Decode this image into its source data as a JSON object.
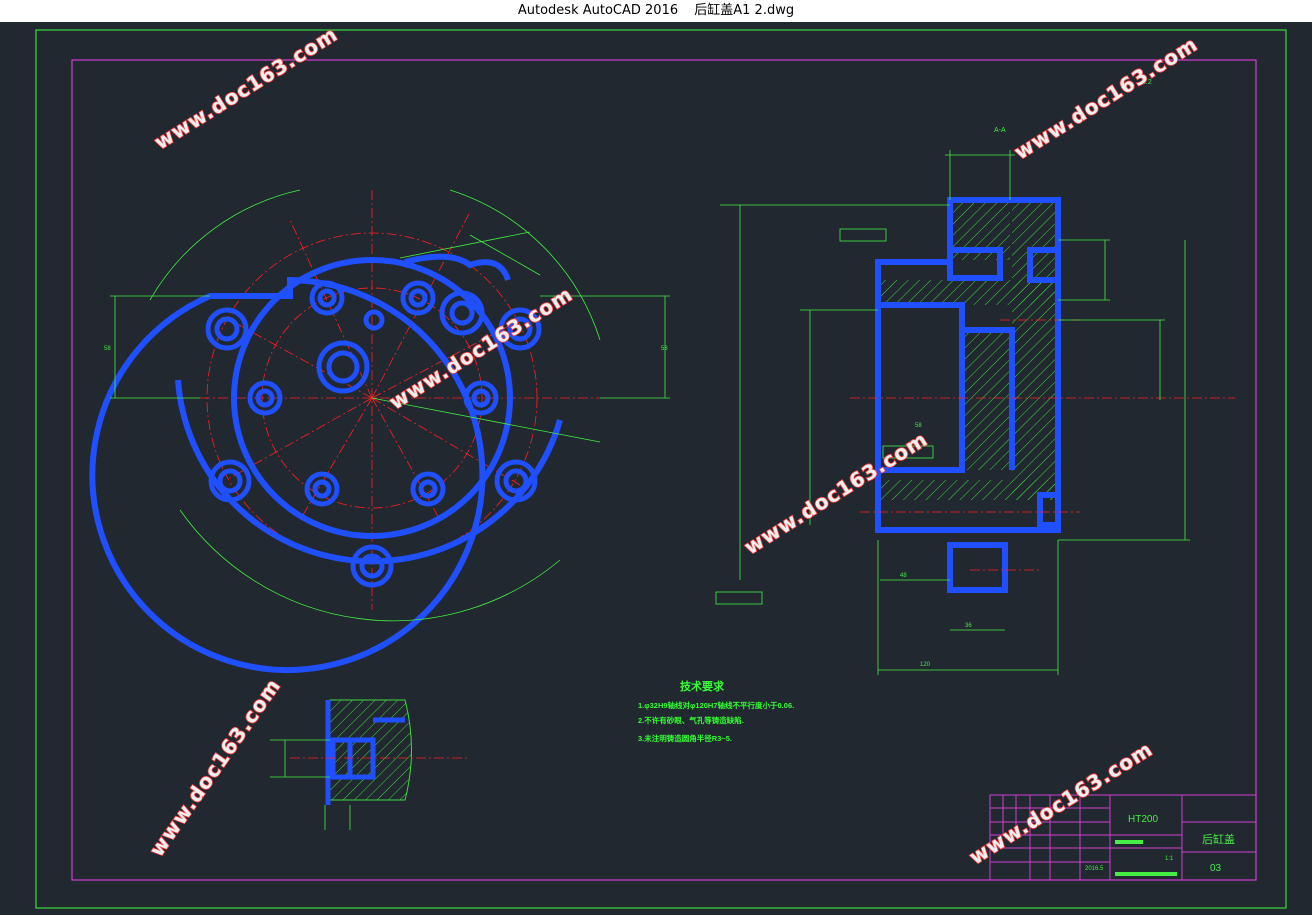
{
  "window": {
    "app": "Autodesk AutoCAD 2016",
    "file": "后缸盖A1 2.dwg"
  },
  "drawing": {
    "section_label": "A-A",
    "tech_req": {
      "title": "技术要求",
      "lines": [
        "1.φ32H9轴线对φ120H7轴线不平行度小于0.06.",
        "2.不许有砂眼、气孔等铸造缺陷.",
        "3.未注明铸造圆角半径R3~5."
      ]
    },
    "title_block": {
      "material": "HT200",
      "part_name": "后缸盖",
      "drawing_no": "03",
      "scale": "1:1",
      "year": "2016.5"
    },
    "watermark": "www.doc163.com",
    "dims": {
      "d1": "58",
      "d2": "70",
      "d3": "120",
      "d4": "36",
      "d5": "48",
      "d6": "3.2"
    }
  },
  "colors": {
    "background": "#212830",
    "border_outer": "#3fd93f",
    "border_inner": "#d040d0",
    "geometry": "#1f4fff",
    "dimension": "#44ee44",
    "centerline": "#ff2020",
    "hatch": "#3fd93f"
  }
}
